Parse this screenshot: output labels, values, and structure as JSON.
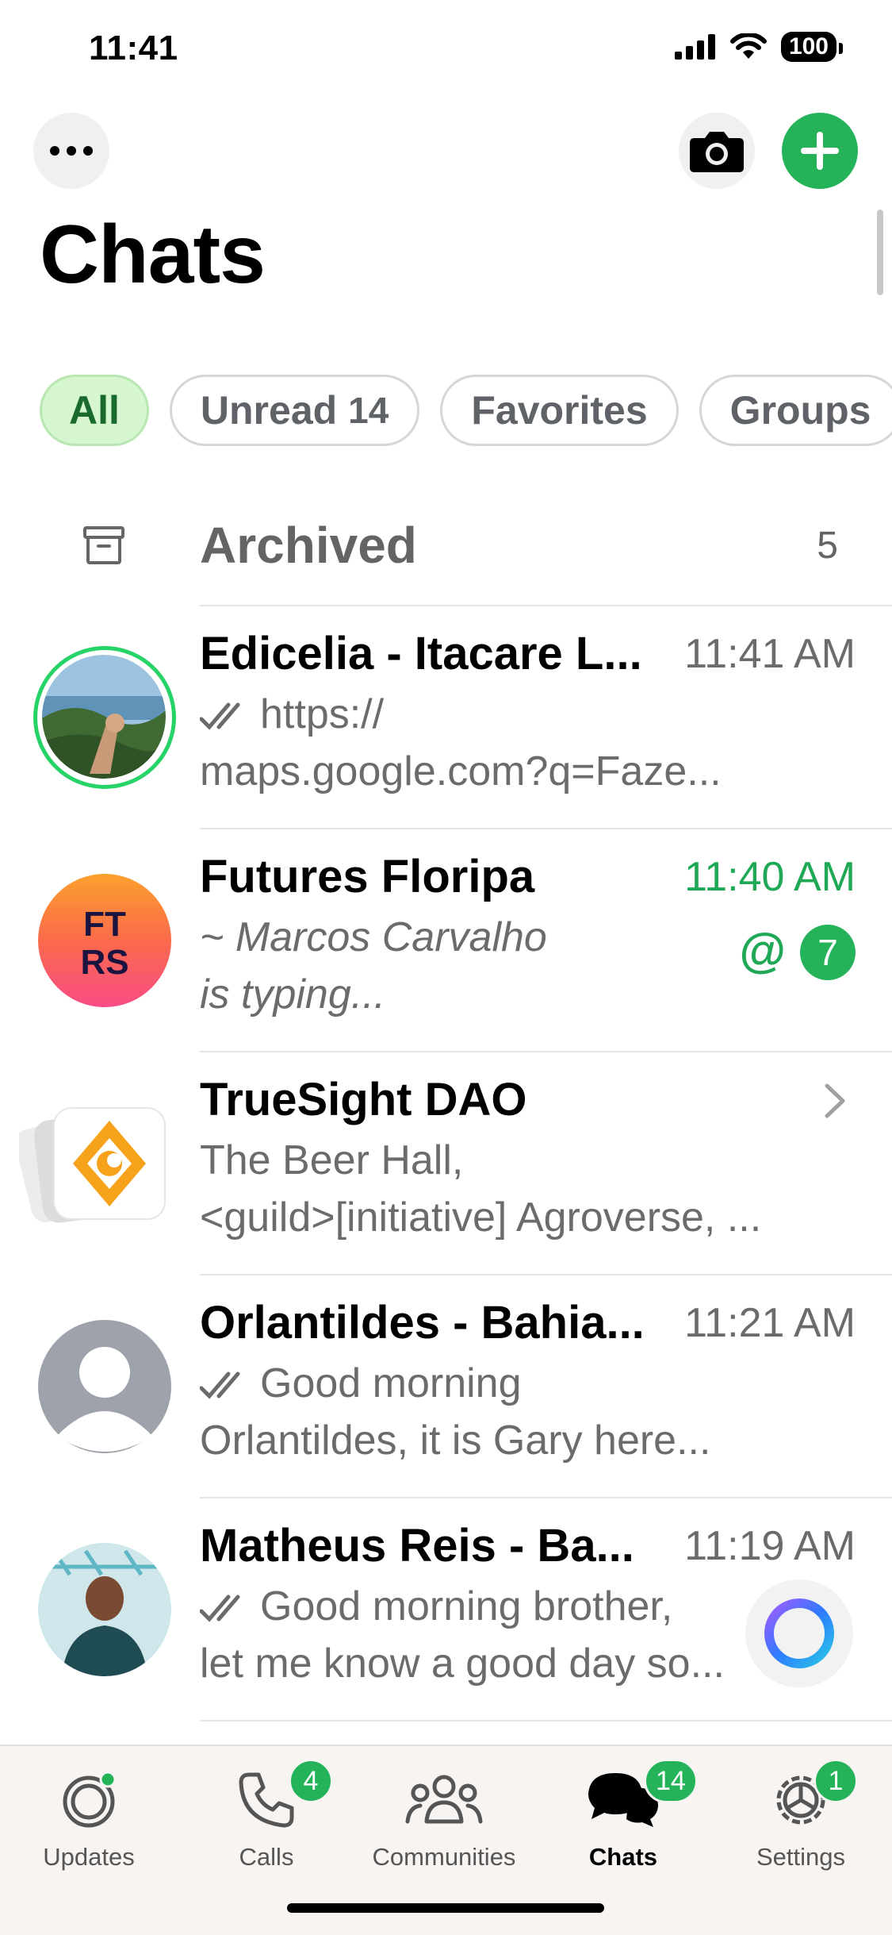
{
  "status": {
    "time": "11:41",
    "battery": "100"
  },
  "header": {
    "title": "Chats"
  },
  "filters": [
    {
      "label": "All",
      "count": ""
    },
    {
      "label": "Unread",
      "count": "14"
    },
    {
      "label": "Favorites",
      "count": ""
    },
    {
      "label": "Groups",
      "count": ""
    }
  ],
  "archived": {
    "label": "Archived",
    "count": "5"
  },
  "chats": [
    {
      "name": "Edicelia - Itacare L...",
      "time": "11:41 AM",
      "preview1": "https://",
      "preview2": "maps.google.com?q=Faze..."
    },
    {
      "name": "Futures Floripa",
      "time": "11:40 AM",
      "preview1": "~ Marcos Carvalho",
      "preview2": "is typing...",
      "mention": "@",
      "unread": "7",
      "avatar_text": "FT RS"
    },
    {
      "name": "TrueSight DAO",
      "time": "",
      "preview1": "The Beer Hall,",
      "preview2": "<guild>[initiative] Agroverse, ..."
    },
    {
      "name": "Orlantildes - Bahia...",
      "time": "11:21 AM",
      "preview1": "Good morning",
      "preview2": "Orlantildes, it is Gary here..."
    },
    {
      "name": "Matheus Reis - Ba...",
      "time": "11:19 AM",
      "preview1": "Good morning brother,",
      "preview2": "let me know a good day so..."
    }
  ],
  "tabs": [
    {
      "label": "Updates",
      "badge": ""
    },
    {
      "label": "Calls",
      "badge": "4"
    },
    {
      "label": "Communities",
      "badge": ""
    },
    {
      "label": "Chats",
      "badge": "14"
    },
    {
      "label": "Settings",
      "badge": "1"
    }
  ],
  "colors": {
    "accent": "#25b35a",
    "accent_text": "#1fa855",
    "secondary_text": "#6b6b6b"
  },
  "icons": [
    "more-icon",
    "camera-icon",
    "plus-icon",
    "archive-icon",
    "double-check-icon",
    "chevron-right-icon",
    "meta-ai-icon",
    "updates-icon",
    "calls-icon",
    "communities-icon",
    "chats-icon",
    "settings-icon"
  ]
}
